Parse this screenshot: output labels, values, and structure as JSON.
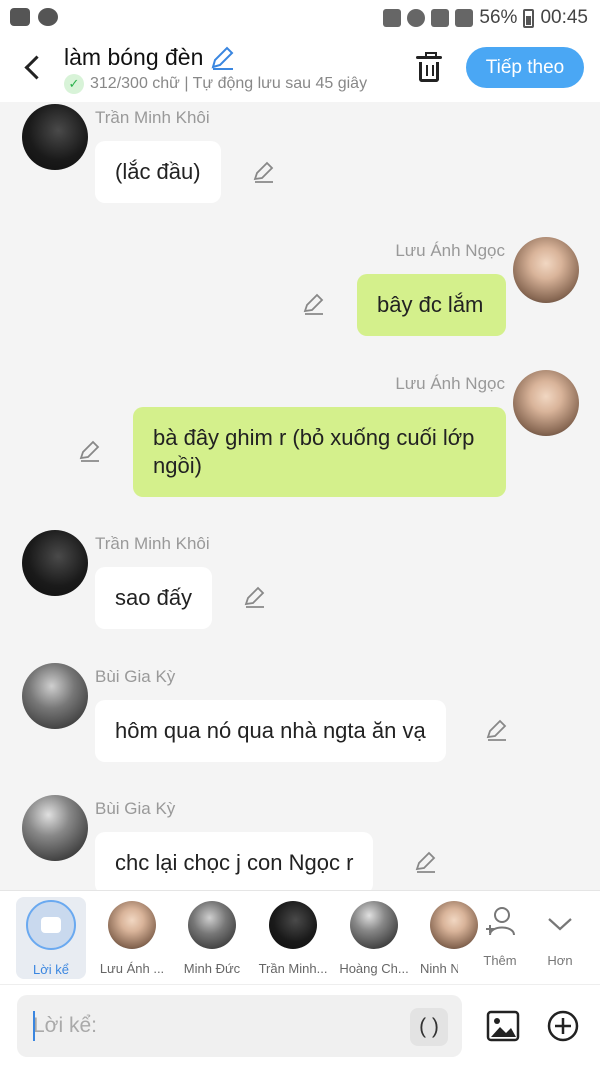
{
  "status_bar": {
    "battery": "56%",
    "time": "00:45"
  },
  "header": {
    "title": "làm bóng đèn",
    "subtitle": "312/300 chữ | Tự động lưu sau 45 giây",
    "next_label": "Tiếp theo"
  },
  "messages": [
    {
      "sender": "Trần Minh Khôi",
      "text": "(lắc đầu)",
      "mine": false
    },
    {
      "sender": "Lưu Ánh Ngọc",
      "text": "bây đc lắm",
      "mine": true
    },
    {
      "sender": "Lưu Ánh Ngọc",
      "text": "bà đây ghim r (bỏ xuống cuối lớp ngồi)",
      "mine": true
    },
    {
      "sender": "Trần Minh Khôi",
      "text": "sao đấy",
      "mine": false
    },
    {
      "sender": "Bùi Gia Kỳ",
      "text": "hôm qua nó qua nhà ngta ăn vạ",
      "mine": false
    },
    {
      "sender": "Bùi Gia Kỳ",
      "text": "chc lại chọc j con Ngọc r",
      "mine": false
    }
  ],
  "characters": [
    {
      "name": "Lời kể"
    },
    {
      "name": "Lưu Ánh ..."
    },
    {
      "name": "Minh Đức"
    },
    {
      "name": "Trần Minh..."
    },
    {
      "name": "Hoàng Ch..."
    },
    {
      "name": "Ninh N"
    }
  ],
  "tools": {
    "add_label": "Thêm",
    "more_label": "Hơn"
  },
  "input": {
    "placeholder": "Lời kể:",
    "paren_label": "( )"
  },
  "colors": {
    "accent": "#4aa7f4",
    "my_bubble": "#d4f08c",
    "bubble": "#ffffff",
    "background": "#f4f4f4"
  }
}
